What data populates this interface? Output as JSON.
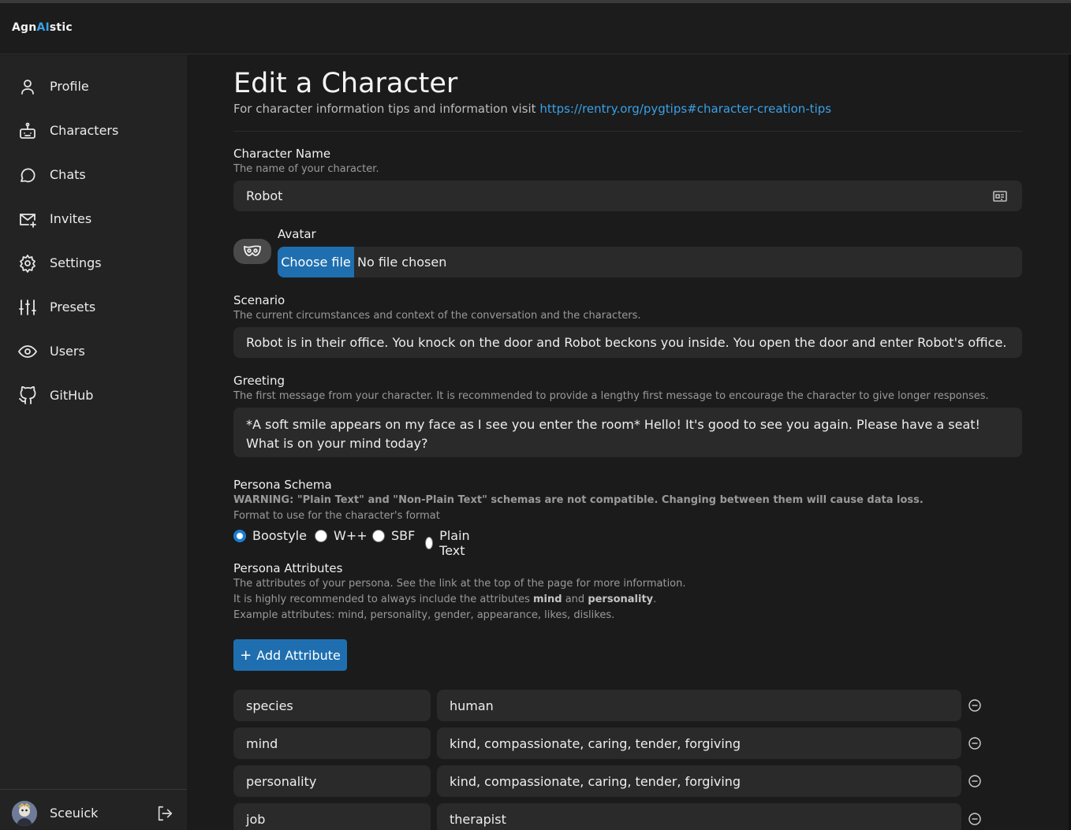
{
  "app": {
    "brand_pre": "Agn",
    "brand_ai": "AI",
    "brand_post": "stic"
  },
  "sidebar": {
    "items": [
      {
        "label": "Profile",
        "icon": "user-icon"
      },
      {
        "label": "Characters",
        "icon": "bot-icon"
      },
      {
        "label": "Chats",
        "icon": "chat-bubble-icon"
      },
      {
        "label": "Invites",
        "icon": "mail-plus-icon"
      },
      {
        "label": "Settings",
        "icon": "gear-icon"
      },
      {
        "label": "Presets",
        "icon": "sliders-icon"
      },
      {
        "label": "Users",
        "icon": "eye-icon"
      },
      {
        "label": "GitHub",
        "icon": "github-icon"
      }
    ],
    "user": {
      "name": "Sceuick"
    }
  },
  "page": {
    "title": "Edit a Character",
    "subtitle_text": "For character information tips and information visit",
    "subtitle_link": "https://rentry.org/pygtips#character-creation-tips"
  },
  "form": {
    "name": {
      "label": "Character Name",
      "help": "The name of your character.",
      "value": "Robot"
    },
    "avatar": {
      "label": "Avatar",
      "button": "Choose file",
      "status": "No file chosen"
    },
    "scenario": {
      "label": "Scenario",
      "help": "The current circumstances and context of the conversation and the characters.",
      "value": "Robot is in their office. You knock on the door and Robot beckons you inside. You open the door and enter Robot's office."
    },
    "greeting": {
      "label": "Greeting",
      "help": "The first message from your character. It is recommended to provide a lengthy first message to encourage the character to give longer responses.",
      "value": "*A soft smile appears on my face as I see you enter the room* Hello! It's good to see you again. Please have a seat! What is on your mind today?"
    },
    "schema": {
      "label": "Persona Schema",
      "warning": "WARNING: \"Plain Text\" and \"Non-Plain Text\" schemas are not compatible. Changing between them will cause data loss.",
      "help": "Format to use for the character's format",
      "options": [
        "Boostyle",
        "W++",
        "SBF",
        "Plain Text"
      ],
      "selected": "Boostyle"
    },
    "attributes": {
      "label": "Persona Attributes",
      "help1": "The attributes of your persona. See the link at the top of the page for more information.",
      "help2_pre": "It is highly recommended to always include the attributes",
      "help2_b1": "mind",
      "help2_and": "and",
      "help2_b2": "personality",
      "help2_post": ".",
      "help3": "Example attributes: mind, personality, gender, appearance, likes, dislikes.",
      "add_button": "Add Attribute",
      "rows": [
        {
          "key": "species",
          "value": "human"
        },
        {
          "key": "mind",
          "value": "kind, compassionate, caring, tender, forgiving"
        },
        {
          "key": "personality",
          "value": "kind, compassionate, caring, tender, forgiving"
        },
        {
          "key": "job",
          "value": "therapist"
        }
      ]
    }
  },
  "colors": {
    "accent": "#3aa0e6",
    "button": "#1f6fb0",
    "background": "#1b1b1b",
    "sidebar": "#232323",
    "field": "#2a2a2a"
  }
}
